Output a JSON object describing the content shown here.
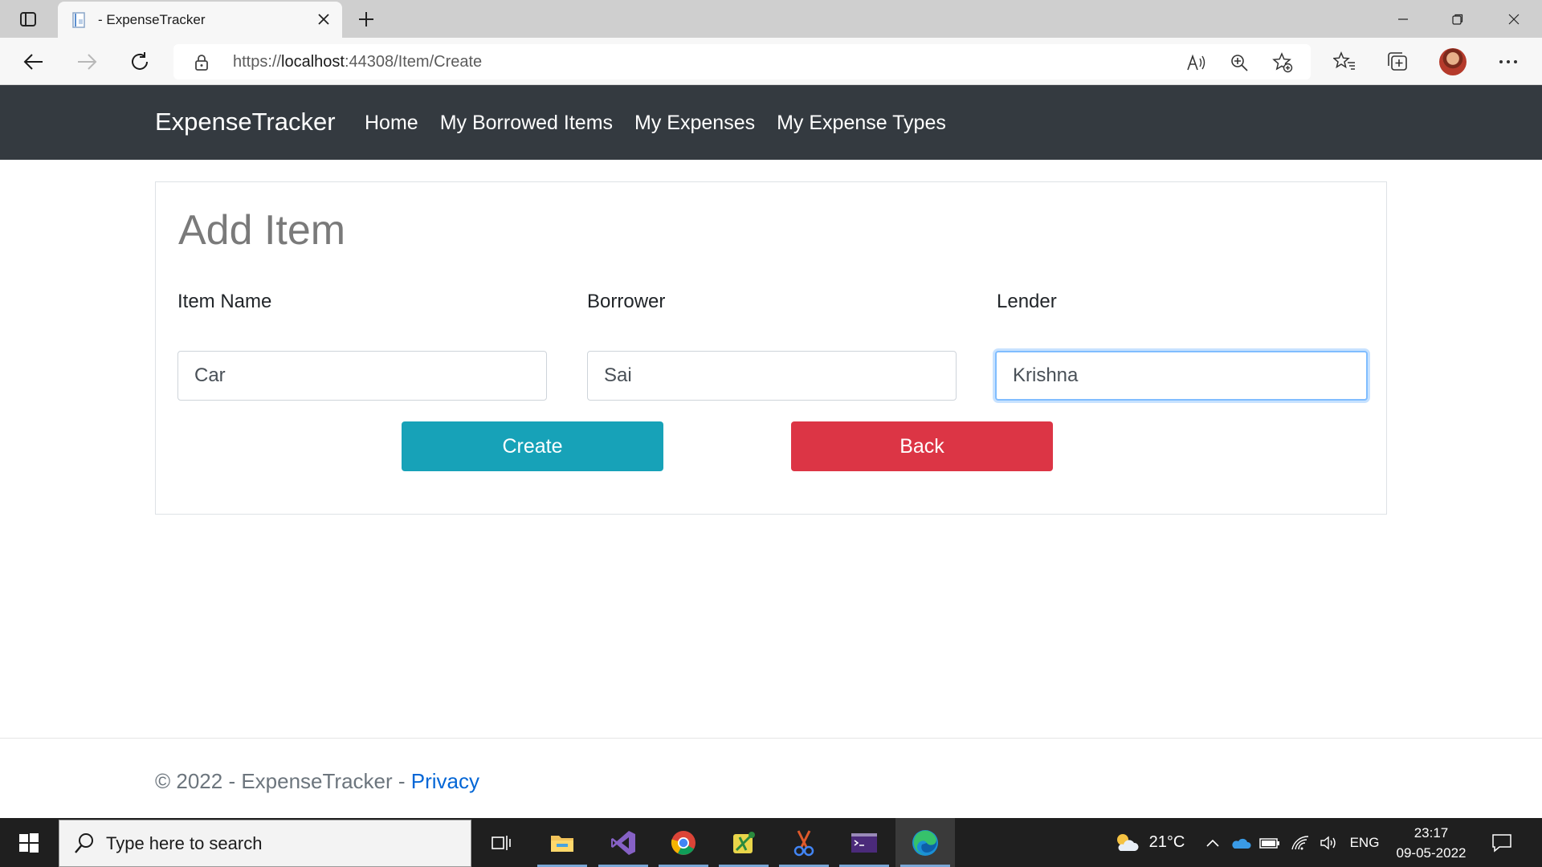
{
  "browser": {
    "tab_title": "- ExpenseTracker",
    "url_scheme": "https://",
    "url_host": "localhost",
    "url_rest": ":44308/Item/Create"
  },
  "navbar": {
    "brand": "ExpenseTracker",
    "links": [
      "Home",
      "My Borrowed Items",
      "My Expenses",
      "My Expense Types"
    ]
  },
  "form": {
    "heading": "Add Item",
    "fields": [
      {
        "label": "Item Name",
        "value": "Car"
      },
      {
        "label": "Borrower",
        "value": "Sai"
      },
      {
        "label": "Lender",
        "value": "Krishna"
      }
    ],
    "create_label": "Create",
    "back_label": "Back"
  },
  "footer": {
    "text": "© 2022 - ExpenseTracker - ",
    "privacy_label": "Privacy"
  },
  "taskbar": {
    "search_placeholder": "Type here to search",
    "weather": "21°C",
    "language": "ENG",
    "time": "23:17",
    "date": "09-05-2022"
  },
  "colors": {
    "navbar": "#343a40",
    "create_button": "#17a2b8",
    "back_button": "#dc3545",
    "link": "#0366d6"
  }
}
